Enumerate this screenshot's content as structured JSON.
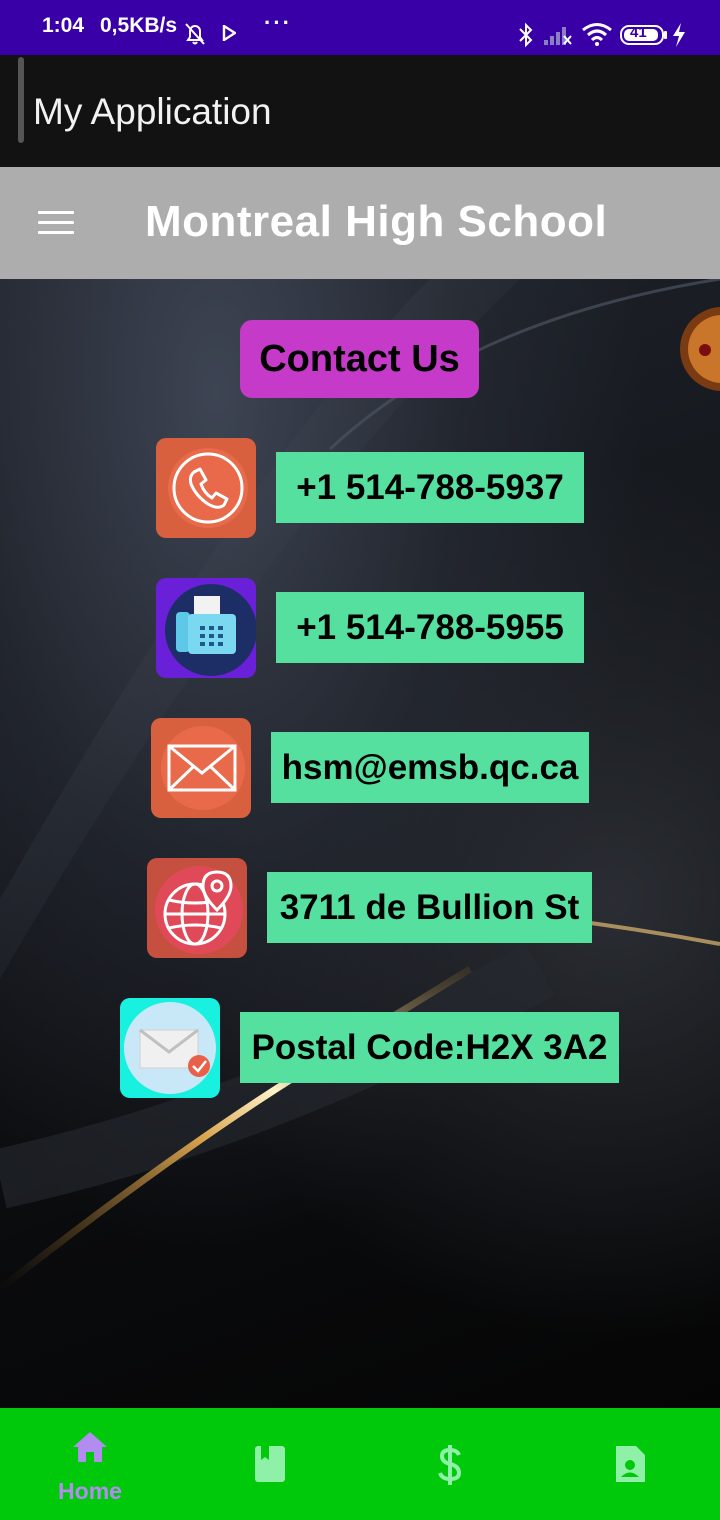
{
  "status_bar": {
    "time": "1:04",
    "speed": "0,5KB/s",
    "dots": "···",
    "battery": "41"
  },
  "app_bar": {
    "title": "My Application"
  },
  "toolbar": {
    "title": "Montreal High School"
  },
  "content": {
    "heading": "Contact Us",
    "contacts": [
      {
        "icon": "phone-icon",
        "value": "+1 514-788-5937"
      },
      {
        "icon": "fax-icon",
        "value": "+1 514-788-5955"
      },
      {
        "icon": "email-icon",
        "value": "hsm@emsb.qc.ca"
      },
      {
        "icon": "globe-location-icon",
        "value": "3711 de Bullion St"
      },
      {
        "icon": "mail-verified-icon",
        "value": "Postal Code:H2X 3A2"
      }
    ]
  },
  "bottom_nav": {
    "items": [
      {
        "icon": "home-icon",
        "label": "Home",
        "selected": true
      },
      {
        "icon": "book-icon",
        "label": ""
      },
      {
        "icon": "dollar-icon",
        "label": ""
      },
      {
        "icon": "contact-card-icon",
        "label": ""
      }
    ],
    "selected_color": "#b38cf0",
    "unselected_color": "#8ff0a8"
  },
  "colors": {
    "status_bar": "#3a00a8",
    "app_bar": "#121212",
    "toolbar": "#adadad",
    "heading_button": "#c53ac8",
    "contact_label": "#55e0a0",
    "bottom_nav": "#00c80a"
  }
}
